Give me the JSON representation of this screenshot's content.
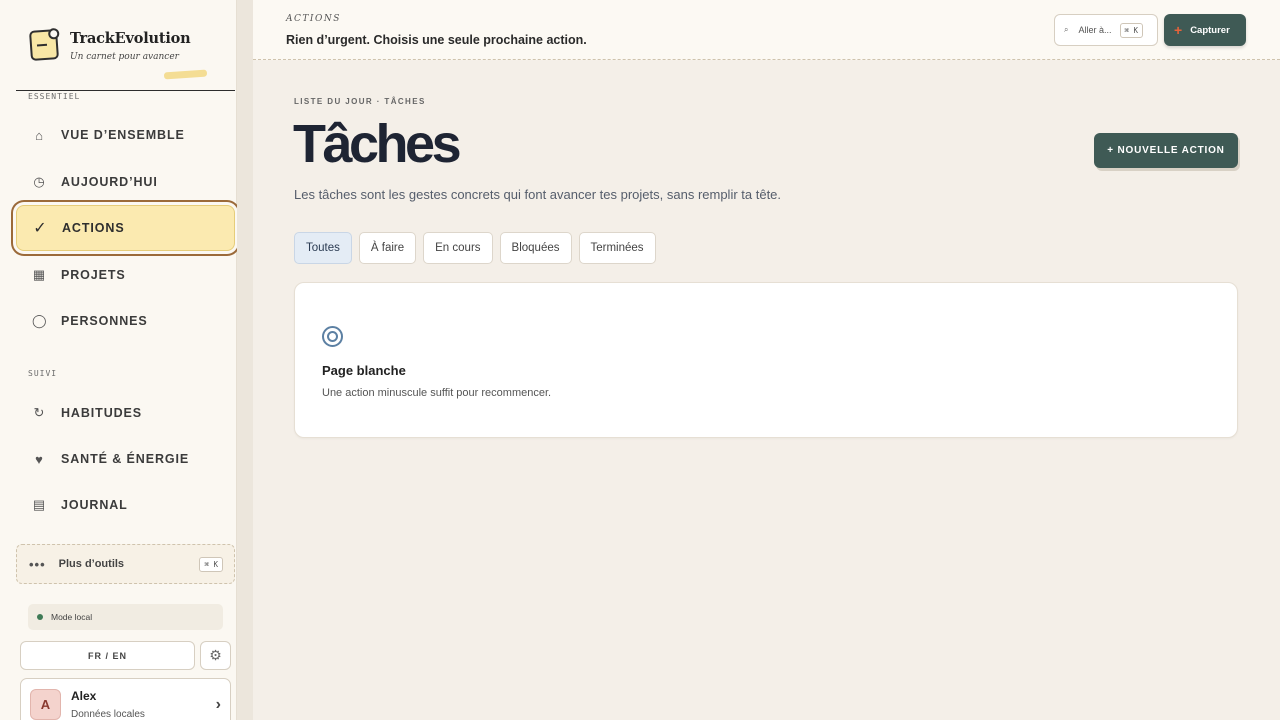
{
  "app": {
    "name": "TrackEvolution",
    "tagline": "Un carnet pour avancer"
  },
  "sidebar": {
    "section_essentiel": "ESSENTIEL",
    "section_suivi": "SUIVI",
    "items": [
      {
        "label": "VUE D’ENSEMBLE",
        "icon": "home-icon",
        "glyph": "⌂"
      },
      {
        "label": "AUJOURD’HUI",
        "icon": "clock-icon",
        "glyph": "◷"
      },
      {
        "label": "ACTIONS",
        "icon": "check-icon",
        "glyph": "✓",
        "active": true
      },
      {
        "label": "PROJETS",
        "icon": "grid-icon",
        "glyph": "▦"
      },
      {
        "label": "PERSONNES",
        "icon": "circle-icon",
        "glyph": "◯"
      },
      {
        "label": "HABITUDES",
        "icon": "refresh-icon",
        "glyph": "↻"
      },
      {
        "label": "SANTÉ & ÉNERGIE",
        "icon": "heart-icon",
        "glyph": "♥"
      },
      {
        "label": "JOURNAL",
        "icon": "journal-icon",
        "glyph": "▤"
      }
    ],
    "tools": {
      "label": "Plus d’outils",
      "shortcut": "⌘ K"
    },
    "mode": "Mode local",
    "language": "FR / EN",
    "settings_glyph": "⚙",
    "user": {
      "initial": "A",
      "name": "Alex",
      "subtitle": "Données locales",
      "chevron": "›"
    }
  },
  "header": {
    "eyebrow": "ACTIONS",
    "subtitle": "Rien d’urgent. Choisis une seule prochaine action.",
    "goto": {
      "icon": "⌕",
      "label": "Aller à...",
      "shortcut": "⌘ K"
    },
    "capture": {
      "plus": "+",
      "label": "Capturer"
    }
  },
  "main": {
    "eyebrow": "LISTE DU JOUR · TÂCHES",
    "title": "Tâches",
    "new_action": "+ NOUVELLE ACTION",
    "description": "Les tâches sont les gestes concrets qui font avancer tes projets, sans remplir ta tête.",
    "filters": [
      {
        "label": "Toutes",
        "active": true
      },
      {
        "label": "À faire"
      },
      {
        "label": "En cours"
      },
      {
        "label": "Bloquées"
      },
      {
        "label": "Terminées"
      }
    ],
    "empty": {
      "title": "Page blanche",
      "description": "Une action minuscule suffit pour recommencer."
    }
  },
  "colors": {
    "accent": "#3f5a55",
    "active_nav_bg": "#fbeab0",
    "active_outline": "#9b6a3a",
    "status_dot": "#3f7a56"
  }
}
